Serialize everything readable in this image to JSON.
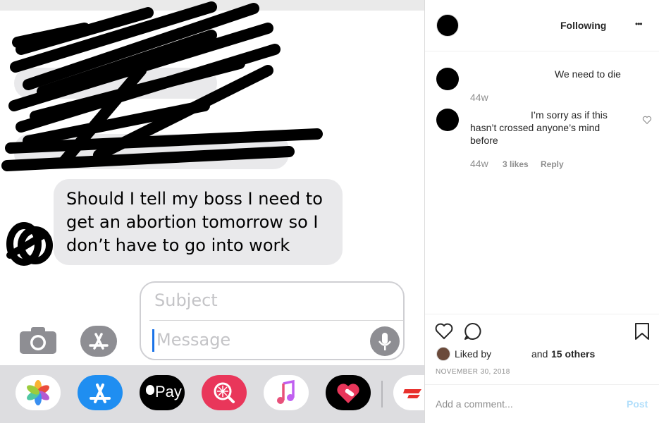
{
  "screenshot": {
    "message_text": "Should I tell my boss I need to get an abortion tomorrow so I don’t have to go into work",
    "message_lines": [
      "Should I tell my boss I need to",
      "get an abortion tomorrow so I",
      "don’t have to go into work"
    ],
    "compose_subject_placeholder": "Subject",
    "compose_message_placeholder": "Message",
    "apple_pay_label": "Pay"
  },
  "post_panel": {
    "follow_status": "Following",
    "more_glyph": "•••",
    "comments": [
      {
        "text": "We need to die",
        "age": "44w"
      },
      {
        "text_lines": [
          "I’m sorry as if this",
          "hasn’t crossed anyone’s mind",
          "before"
        ],
        "age": "44w",
        "likes": "3 likes",
        "reply_label": "Reply"
      }
    ],
    "liked_by_label": "Liked by",
    "and_label": "and",
    "others_label": "15 others",
    "date": "NOVEMBER 30, 2018",
    "comment_placeholder": "Add a comment...",
    "post_button": "Post"
  },
  "colors": {
    "link_blue": "#b2dffb",
    "bubble_gray": "#e9e9eb",
    "caret_blue": "#1a73e8"
  }
}
